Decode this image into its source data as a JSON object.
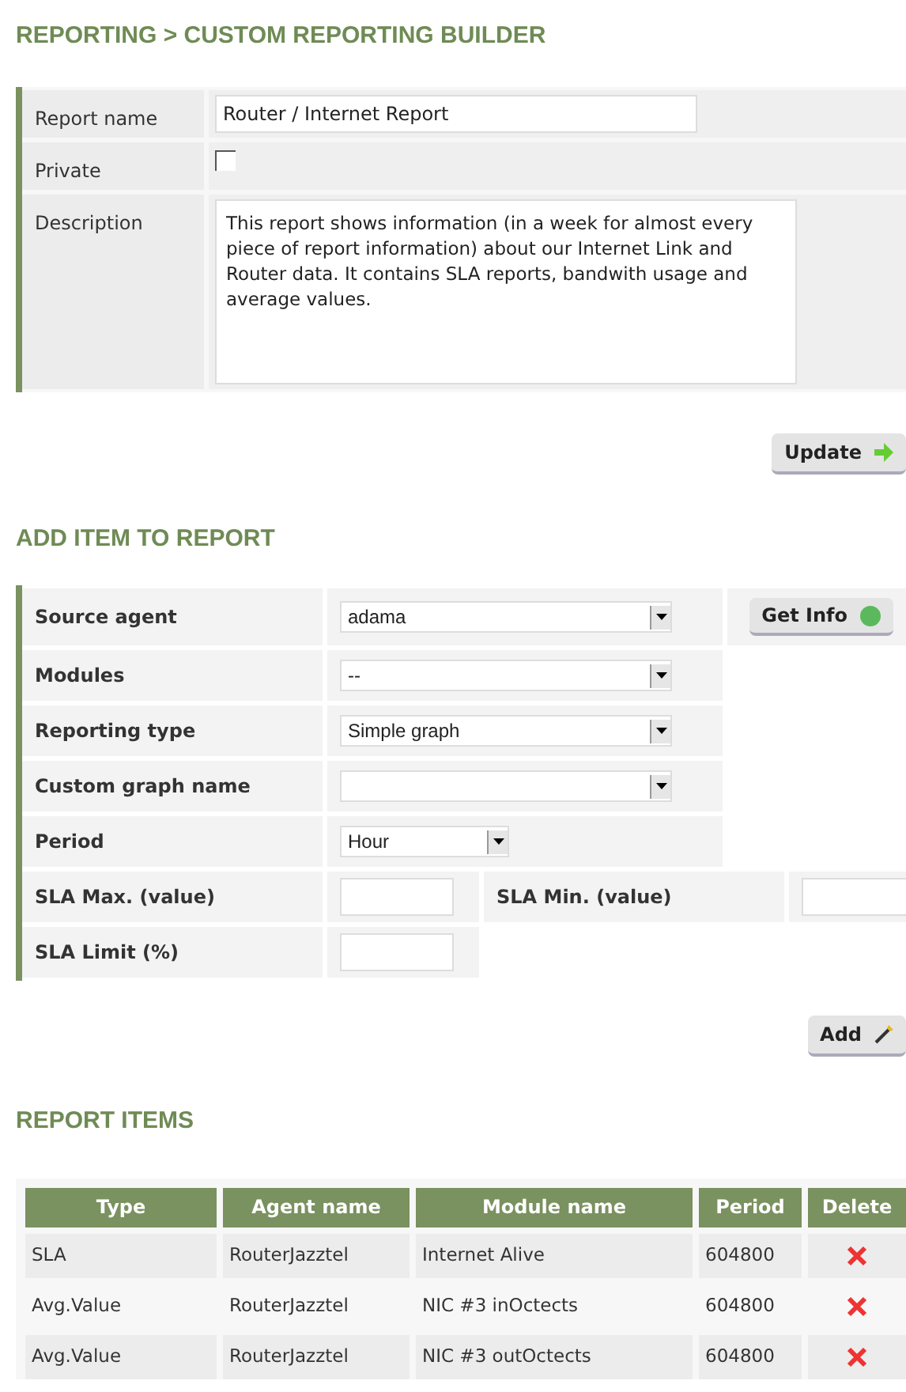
{
  "page_title": "REPORTING > CUSTOM REPORTING BUILDER",
  "report_form": {
    "fields": [
      {
        "kind": "text",
        "label": "Report name",
        "value": "Router / Internet Report"
      },
      {
        "kind": "checkbox",
        "label": "Private",
        "checked": false
      },
      {
        "kind": "textarea",
        "label": "Description",
        "value": "This report shows information (in a week for almost every piece of report information) about our Internet Link and Router data. It contains SLA reports, bandwith usage and average values."
      }
    ],
    "button": "Update"
  },
  "add_item": {
    "heading": "ADD ITEM TO REPORT",
    "rows": [
      {
        "cells": [
          {
            "kind": "label",
            "text": "Source agent"
          },
          {
            "kind": "select",
            "value": "adama"
          },
          {
            "kind": "button",
            "text": "Get Info"
          }
        ]
      },
      {
        "cells": [
          {
            "kind": "label",
            "text": "Modules"
          },
          {
            "kind": "select",
            "value": "--"
          }
        ]
      },
      {
        "cells": [
          {
            "kind": "label",
            "text": "Reporting type"
          },
          {
            "kind": "select",
            "value": "Simple graph"
          }
        ]
      },
      {
        "cells": [
          {
            "kind": "label",
            "text": "Custom graph name"
          },
          {
            "kind": "select"
          }
        ]
      },
      {
        "cells": [
          {
            "kind": "label",
            "text": "Period"
          },
          {
            "kind": "short_select",
            "value": "Hour"
          }
        ]
      },
      {
        "cells": [
          {
            "kind": "label",
            "text": "SLA Max. (value)"
          },
          {
            "kind": "input"
          },
          {
            "kind": "label",
            "text": "SLA Min. (value)"
          },
          {
            "kind": "input"
          }
        ]
      },
      {
        "cells": [
          {
            "kind": "label",
            "text": "SLA Limit (%)"
          },
          {
            "kind": "input"
          }
        ]
      }
    ],
    "button": "Add"
  },
  "report_items": {
    "heading": "REPORT ITEMS",
    "columns": [
      "Type",
      "Agent name",
      "Module name",
      "Period",
      "Delete"
    ],
    "rows": [
      {
        "type": "SLA",
        "agent_name": "RouterJazztel",
        "module_name": "Internet Alive",
        "period": "604800"
      },
      {
        "type": "Avg.Value",
        "agent_name": "RouterJazztel",
        "module_name": "NIC #3 inOctects",
        "period": "604800"
      },
      {
        "type": "Avg.Value",
        "agent_name": "RouterJazztel",
        "module_name": "NIC #3 outOctects",
        "period": "604800"
      }
    ]
  }
}
